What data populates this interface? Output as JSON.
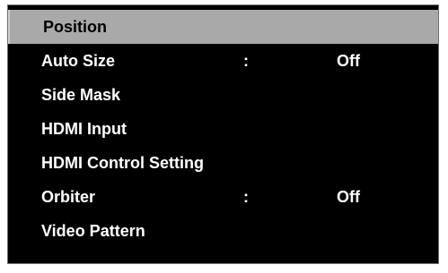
{
  "menu": {
    "items": [
      {
        "label": "Position",
        "separator": "",
        "value": "",
        "selected": true
      },
      {
        "label": "Auto Size",
        "separator": ":",
        "value": "Off",
        "selected": false
      },
      {
        "label": "Side Mask",
        "separator": "",
        "value": "",
        "selected": false
      },
      {
        "label": "HDMI Input",
        "separator": "",
        "value": "",
        "selected": false
      },
      {
        "label": "HDMI Control Setting",
        "separator": "",
        "value": "",
        "selected": false
      },
      {
        "label": "Orbiter",
        "separator": ":",
        "value": "Off",
        "selected": false
      },
      {
        "label": "Video Pattern",
        "separator": "",
        "value": "",
        "selected": false
      }
    ]
  },
  "colors": {
    "background": "#000000",
    "text": "#ffffff",
    "selected_background": "#a9a9a9",
    "selected_text": "#000000"
  }
}
